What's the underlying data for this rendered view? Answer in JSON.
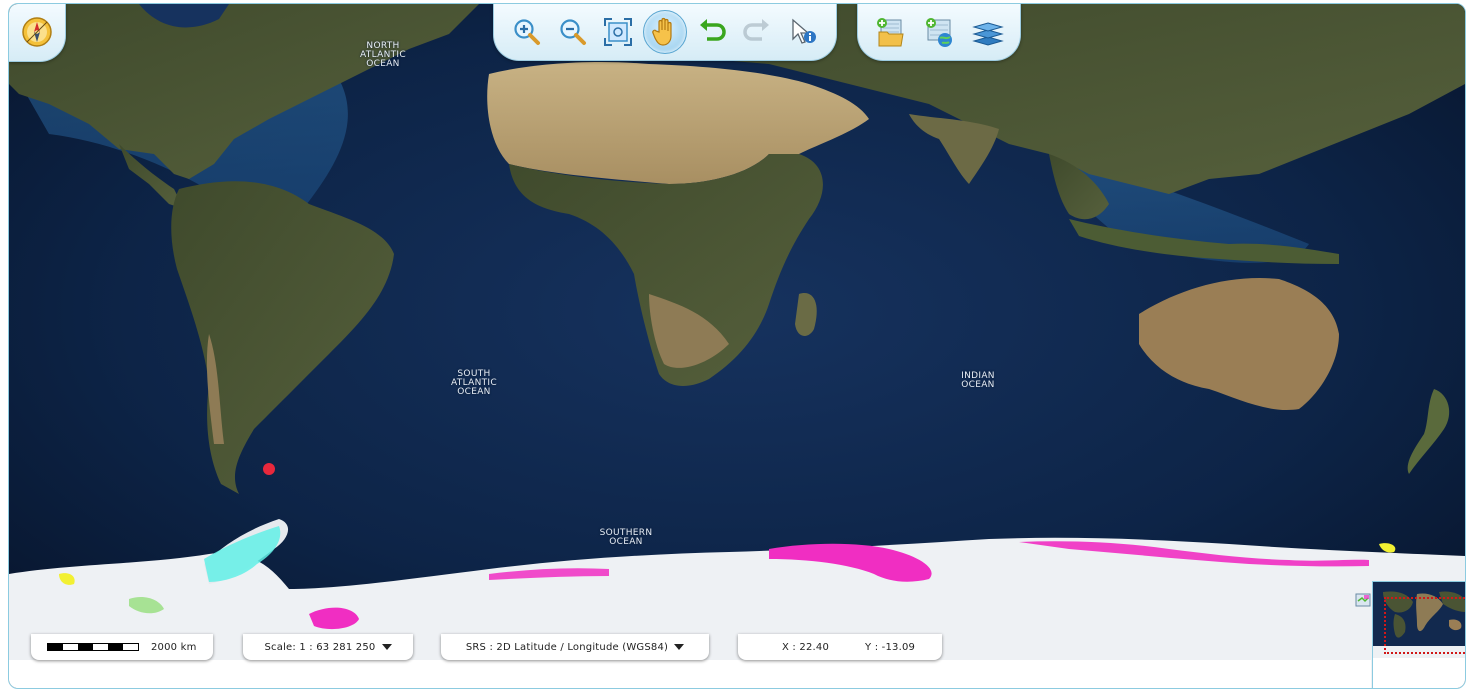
{
  "ocean_labels": {
    "north_atlantic": [
      "NORTH",
      "ATLANTIC",
      "OCEAN"
    ],
    "south_atlantic": [
      "SOUTH",
      "ATLANTIC",
      "OCEAN"
    ],
    "indian": [
      "INDIAN",
      "OCEAN"
    ],
    "southern": [
      "SOUTHERN",
      "OCEAN"
    ]
  },
  "toolbar": {
    "tools": [
      {
        "name": "zoom-in-icon",
        "state": "enabled"
      },
      {
        "name": "zoom-out-icon",
        "state": "enabled"
      },
      {
        "name": "zoom-extent-icon",
        "state": "enabled"
      },
      {
        "name": "pan-hand-icon",
        "state": "active"
      },
      {
        "name": "undo-icon",
        "state": "enabled"
      },
      {
        "name": "redo-icon",
        "state": "disabled"
      },
      {
        "name": "info-cursor-icon",
        "state": "enabled"
      }
    ],
    "layer_tools": [
      "add-layer-folder-icon",
      "add-web-layer-icon",
      "layers-icon"
    ]
  },
  "compass_icon": "compass-icon",
  "status": {
    "scale_bar_label": "2000 km",
    "scale_text": "Scale: 1 : 63 281 250",
    "srs_text": "SRS : 2D Latitude / Longitude (WGS84)",
    "x_text": "X : 22.40",
    "y_text": "Y : -13.09"
  },
  "colors": {
    "ocean": "#0b1e3c",
    "land": "#4a5434",
    "desert": "#b8a276",
    "ice": "#eef1f4",
    "highlight_magenta": "#f02ec2",
    "highlight_cyan": "#62f0e6",
    "toolbar_border": "#9ccbe0"
  }
}
